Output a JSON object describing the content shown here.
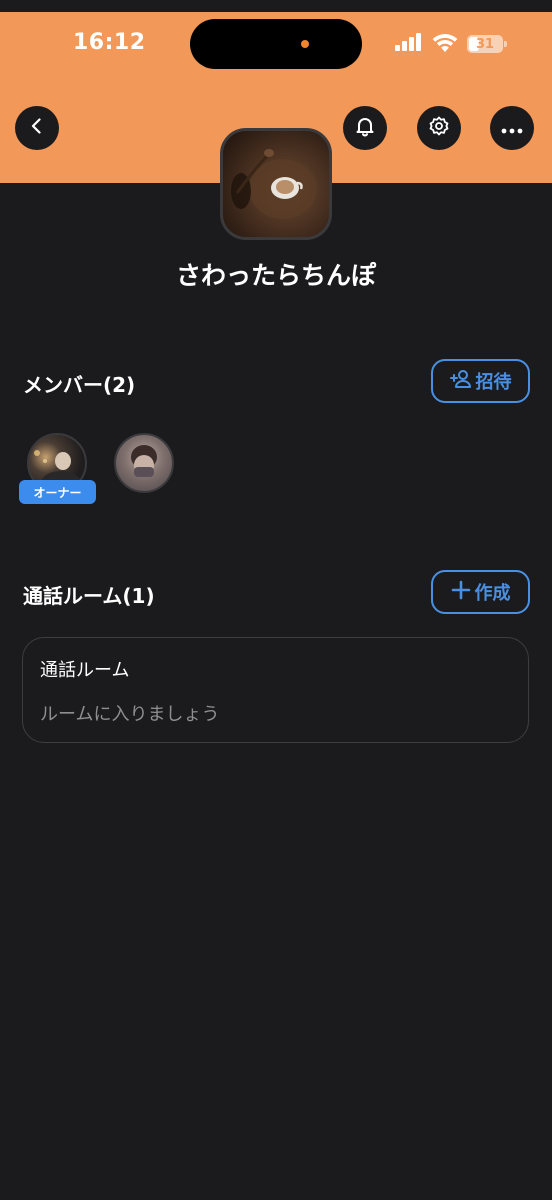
{
  "status_bar": {
    "time": "16:12",
    "battery": "31",
    "battery_level": 0.31
  },
  "header": {
    "back_icon": "chevron-left-icon",
    "actions": [
      "bell-icon",
      "gear-icon",
      "more-horizontal-icon"
    ],
    "background": "#f29959"
  },
  "group": {
    "name": "さわったらちんぽ"
  },
  "members": {
    "title": "メンバー(2)",
    "invite_label": "招待",
    "owner_badge": "オーナー"
  },
  "rooms": {
    "title": "通話ルーム(1)",
    "create_label": "作成",
    "items": [
      {
        "title": "通話ルーム",
        "subtitle": "ルームに入りましょう"
      }
    ]
  },
  "colors": {
    "accent": "#4a90e2",
    "badge": "#3b8cec",
    "background": "#1b1b1d"
  }
}
